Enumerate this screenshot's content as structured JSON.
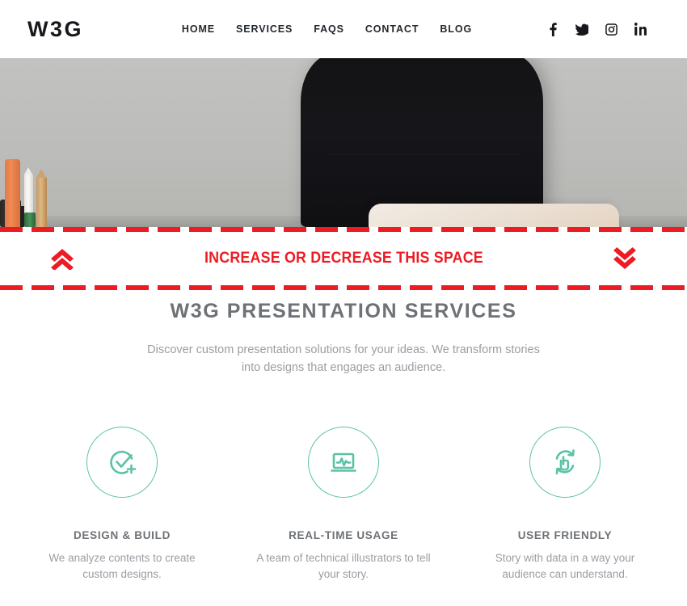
{
  "colors": {
    "accent_red": "#ed1c24",
    "accent_teal": "#5bc2a7",
    "heading_grey": "#6e7175",
    "body_grey": "#9a9ea3",
    "nav_dark": "#23282d"
  },
  "header": {
    "logo": "W3G",
    "nav": [
      {
        "label": "HOME",
        "name": "nav-home"
      },
      {
        "label": "SERVICES",
        "name": "nav-services"
      },
      {
        "label": "FAQS",
        "name": "nav-faqs"
      },
      {
        "label": "CONTACT",
        "name": "nav-contact"
      },
      {
        "label": "BLOG",
        "name": "nav-blog"
      }
    ],
    "social": [
      {
        "icon": "facebook-icon"
      },
      {
        "icon": "twitter-icon"
      },
      {
        "icon": "instagram-icon"
      },
      {
        "icon": "linkedin-icon"
      }
    ]
  },
  "hero": {
    "alt": "desk-photo-laptop-chair"
  },
  "spacer_banner": {
    "label": "INCREASE OR DECREASE THIS SPACE",
    "increase_icon": "chevron-double-up-icon",
    "decrease_icon": "chevron-double-down-icon",
    "border_color": "#ed1c24"
  },
  "services": {
    "title": "W3G PRESENTATION SERVICES",
    "subtitle": "Discover custom presentation solutions for your ideas. We transform stories into designs that engages an audience.",
    "cards": [
      {
        "icon": "check-circle-plus-icon",
        "title": "DESIGN & BUILD",
        "text": "We analyze contents to create custom designs."
      },
      {
        "icon": "laptop-chart-icon",
        "title": "REAL-TIME USAGE",
        "text": "A team of technical illustrators to tell your story."
      },
      {
        "icon": "hand-pointer-refresh-icon",
        "title": "USER FRIENDLY",
        "text": "Story with data in a way your audience can understand."
      }
    ]
  }
}
